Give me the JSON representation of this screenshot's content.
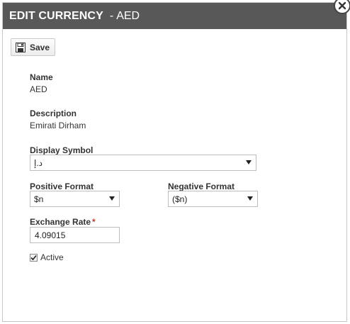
{
  "dialog": {
    "title": "EDIT CURRENCY",
    "separator": "-",
    "code": "AED"
  },
  "toolbar": {
    "save_label": "Save",
    "save_icon": "floppy-disk-icon"
  },
  "fields": {
    "name": {
      "label": "Name",
      "value": "AED"
    },
    "description": {
      "label": "Description",
      "value": "Emirati Dirham"
    },
    "display_symbol": {
      "label": "Display Symbol",
      "value": "د.إ"
    },
    "positive_format": {
      "label": "Positive Format",
      "value": "$n"
    },
    "negative_format": {
      "label": "Negative Format",
      "value": "($n)"
    },
    "exchange_rate": {
      "label": "Exchange Rate",
      "required_mark": "*",
      "value": "4.09015"
    },
    "active": {
      "label": "Active",
      "checked": true
    }
  },
  "colors": {
    "titlebar": "#585858",
    "required": "#c0392b"
  }
}
